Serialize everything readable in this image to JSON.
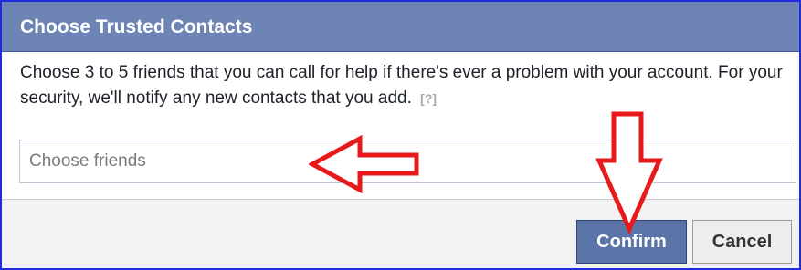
{
  "dialog": {
    "title": "Choose Trusted Contacts",
    "description": "Choose 3 to 5 friends that you can call for help if there's ever a problem with your account. For your security, we'll notify any new contacts that you add.",
    "help_link": "[?]",
    "friends_input": {
      "value": "",
      "placeholder": "Choose friends"
    }
  },
  "footer": {
    "confirm_label": "Confirm",
    "cancel_label": "Cancel"
  },
  "annotations": {
    "arrow_color": "#e8191b",
    "arrow_icons": [
      "left-arrow-icon",
      "down-arrow-icon"
    ]
  },
  "colors": {
    "header_bg": "#6d84b4",
    "dialog_border": "#1f2bdc",
    "confirm_bg": "#5b74a8",
    "footer_bg": "#f2f2f2"
  }
}
